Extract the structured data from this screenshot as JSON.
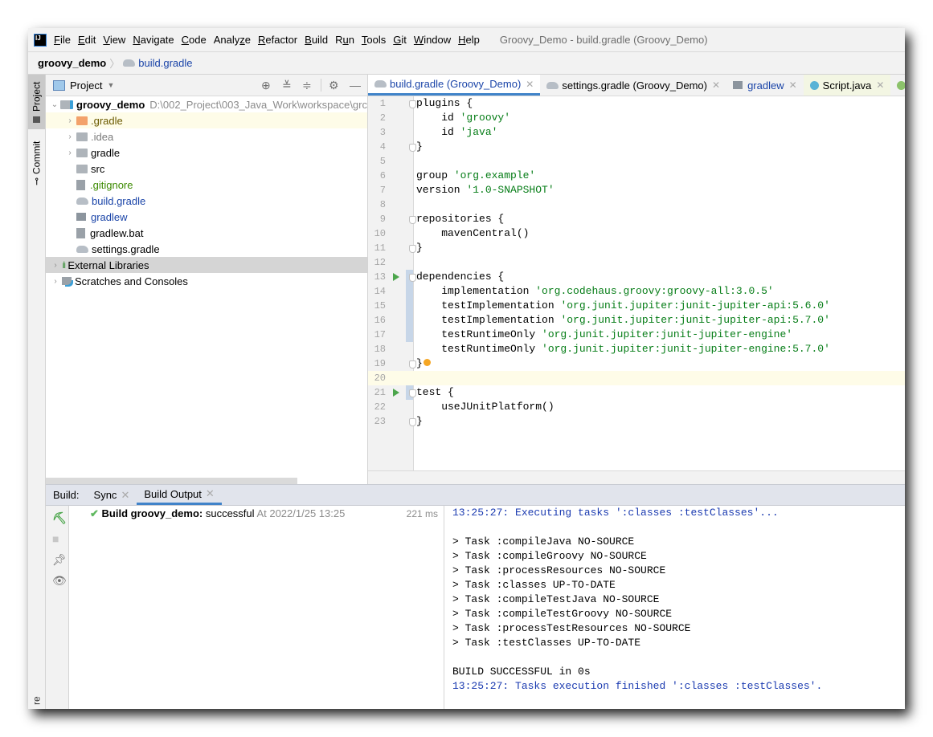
{
  "menubar": {
    "items": [
      "File",
      "Edit",
      "View",
      "Navigate",
      "Code",
      "Analyze",
      "Refactor",
      "Build",
      "Run",
      "Tools",
      "Git",
      "Window",
      "Help"
    ],
    "mnemonics": [
      "F",
      "E",
      "V",
      "N",
      "C",
      "z",
      "R",
      "B",
      "u",
      "T",
      "G",
      "W",
      "H"
    ],
    "window_title": "Groovy_Demo - build.gradle (Groovy_Demo)"
  },
  "navbar": {
    "root": "groovy_demo",
    "file": "build.gradle"
  },
  "left_strip": {
    "project_tab": "Project",
    "commit_tab": "Commit",
    "bottom_tab": "re"
  },
  "project_panel": {
    "title": "Project",
    "root": {
      "name": "groovy_demo",
      "path": "D:\\002_Project\\003_Java_Work\\workspace\\grc"
    },
    "items": [
      {
        "name": ".gradle",
        "type": "folder-excluded",
        "expandable": true,
        "color": "#6b5a00"
      },
      {
        "name": ".idea",
        "type": "folder",
        "expandable": true,
        "color": "#7a7a7a"
      },
      {
        "name": "gradle",
        "type": "folder",
        "expandable": true,
        "color": "#000000"
      },
      {
        "name": "src",
        "type": "folder",
        "expandable": false,
        "color": "#000000"
      },
      {
        "name": ".gitignore",
        "type": "ignore-file",
        "expandable": false,
        "color": "#3c8a00"
      },
      {
        "name": "build.gradle",
        "type": "gradle-file",
        "expandable": false,
        "color": "#1a44a8"
      },
      {
        "name": "gradlew",
        "type": "shell-file",
        "expandable": false,
        "color": "#1a44a8"
      },
      {
        "name": "gradlew.bat",
        "type": "text-file",
        "expandable": false,
        "color": "#000000"
      },
      {
        "name": "settings.gradle",
        "type": "gradle-file",
        "expandable": false,
        "color": "#000000"
      }
    ],
    "external_libraries": "External Libraries",
    "scratches": "Scratches and Consoles"
  },
  "editor": {
    "tabs": [
      {
        "label": "build.gradle (Groovy_Demo)",
        "active": true
      },
      {
        "label": "settings.gradle (Groovy_Demo)",
        "active": false
      },
      {
        "label": "gradlew",
        "active": false
      },
      {
        "label": "Script.java",
        "active": false
      }
    ],
    "lines": [
      [
        {
          "t": "plugins {"
        }
      ],
      [
        {
          "t": "    id "
        },
        {
          "t": "'groovy'",
          "s": 1
        }
      ],
      [
        {
          "t": "    id "
        },
        {
          "t": "'java'",
          "s": 1
        }
      ],
      [
        {
          "t": "}"
        }
      ],
      [],
      [
        {
          "t": "group "
        },
        {
          "t": "'org.example'",
          "s": 1
        }
      ],
      [
        {
          "t": "version "
        },
        {
          "t": "'1.0-SNAPSHOT'",
          "s": 1
        }
      ],
      [],
      [
        {
          "t": "repositories {"
        }
      ],
      [
        {
          "t": "    mavenCentral()"
        }
      ],
      [
        {
          "t": "}"
        }
      ],
      [],
      [
        {
          "t": "dependencies {"
        }
      ],
      [
        {
          "t": "    implementation "
        },
        {
          "t": "'org.codehaus.groovy:groovy-all:3.0.5'",
          "s": 1
        }
      ],
      [
        {
          "t": "    testImplementation "
        },
        {
          "t": "'org.junit.jupiter:junit-jupiter-api:5.6.0'",
          "s": 1
        }
      ],
      [
        {
          "t": "    testImplementation "
        },
        {
          "t": "'org.junit.jupiter:junit-jupiter-api:5.7.0'",
          "s": 1
        }
      ],
      [
        {
          "t": "    testRuntimeOnly "
        },
        {
          "t": "'org.junit.jupiter:junit-jupiter-engine'",
          "s": 1
        }
      ],
      [
        {
          "t": "    testRuntimeOnly "
        },
        {
          "t": "'org.junit.jupiter:junit-jupiter-engine:5.7.0'",
          "s": 1
        }
      ],
      [
        {
          "t": "}"
        }
      ],
      [],
      [
        {
          "t": "test {"
        }
      ],
      [
        {
          "t": "    useJUnitPlatform()"
        }
      ],
      [
        {
          "t": "}"
        }
      ]
    ],
    "current_line": 20,
    "run_lines": [
      13,
      21
    ],
    "fold_lines": [
      1,
      4,
      9,
      11,
      13,
      19,
      21,
      23
    ],
    "bulb_line": 19
  },
  "build_panel": {
    "label": "Build:",
    "tabs": [
      {
        "label": "Sync",
        "active": false
      },
      {
        "label": "Build Output",
        "active": true
      }
    ],
    "result": {
      "title": "Build groovy_demo:",
      "status": "successful",
      "at": "At 2022/1/25 13:25",
      "duration": "221 ms"
    },
    "output": [
      {
        "text": "13:25:27: Executing tasks ':classes :testClasses'...",
        "blue": true
      },
      {
        "text": "",
        "blue": false
      },
      {
        "text": "> Task :compileJava NO-SOURCE",
        "blue": false
      },
      {
        "text": "> Task :compileGroovy NO-SOURCE",
        "blue": false
      },
      {
        "text": "> Task :processResources NO-SOURCE",
        "blue": false
      },
      {
        "text": "> Task :classes UP-TO-DATE",
        "blue": false
      },
      {
        "text": "> Task :compileTestJava NO-SOURCE",
        "blue": false
      },
      {
        "text": "> Task :compileTestGroovy NO-SOURCE",
        "blue": false
      },
      {
        "text": "> Task :processTestResources NO-SOURCE",
        "blue": false
      },
      {
        "text": "> Task :testClasses UP-TO-DATE",
        "blue": false
      },
      {
        "text": "",
        "blue": false
      },
      {
        "text": "BUILD SUCCESSFUL in 0s",
        "blue": false
      },
      {
        "text": "13:25:27: Tasks execution finished ':classes :testClasses'.",
        "blue": true
      }
    ]
  }
}
